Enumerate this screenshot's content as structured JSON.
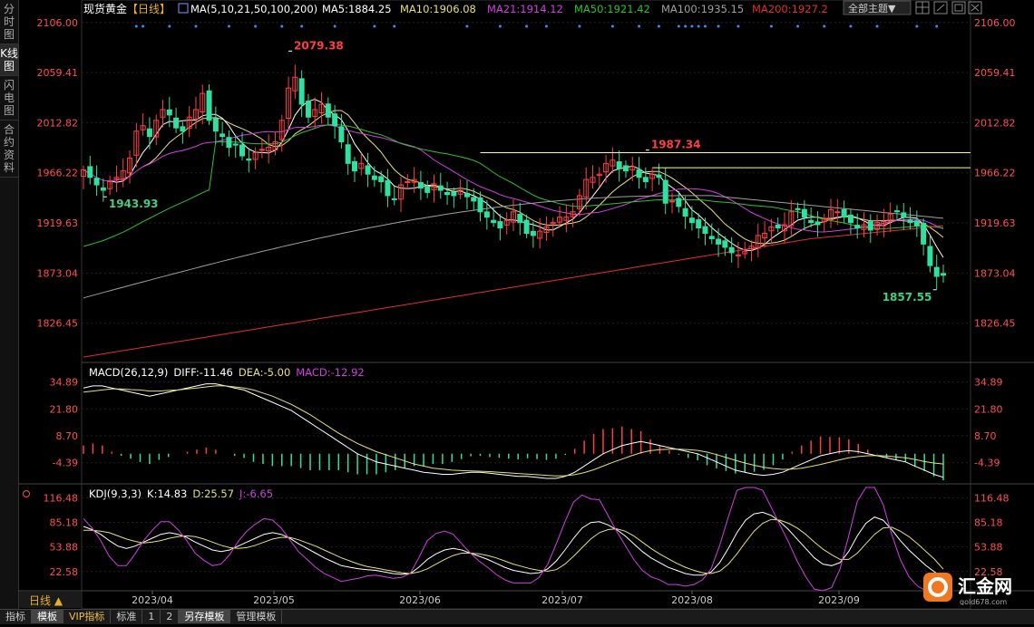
{
  "sidebar": {
    "tabs": [
      {
        "label": "分时图",
        "active": false
      },
      {
        "label": "K线图",
        "active": true
      },
      {
        "label": "闪电图",
        "active": false
      },
      {
        "label": "合约资料",
        "active": false
      }
    ]
  },
  "header": {
    "symbol": "现货黄金",
    "period": "【日线】",
    "ma_params": "MA(5,10,21,50,100,200)",
    "ma_values": [
      {
        "text": "MA5:1884.25",
        "color": "#ffffff"
      },
      {
        "text": "MA10:1906.08",
        "color": "#e8e070"
      },
      {
        "text": "MA21:1914.12",
        "color": "#d040e0"
      },
      {
        "text": "MA50:1921.42",
        "color": "#30c030"
      },
      {
        "text": "MA100:1935.15",
        "color": "#a0a0a0"
      },
      {
        "text": "MA200:1927.2",
        "color": "#e03030"
      }
    ],
    "theme_select": "全部主题▼",
    "toolbar_icons": [
      "window-layout-icon",
      "expand-icon",
      "restore-icon",
      "close-icon"
    ]
  },
  "chart_data": [
    {
      "type": "candlestick",
      "title": "现货黄金 日线",
      "ylim": [
        1790,
        2110
      ],
      "y_ticks": [
        "2106.00",
        "2059.41",
        "2012.82",
        "1966.22",
        "1919.63",
        "1873.04",
        "1826.45"
      ],
      "x_ticks": [
        "2023/04",
        "2023/05",
        "2023/06",
        "2023/07",
        "2023/08",
        "2023/09"
      ],
      "period_selector": "日线 ▲",
      "annotations": [
        {
          "label": "2079.38",
          "value": 2079.38,
          "color": "#ff4040"
        },
        {
          "label": "1987.34",
          "value": 1987.34,
          "color": "#ff4040"
        },
        {
          "label": "1943.93",
          "value": 1943.93,
          "color": "#40d080"
        },
        {
          "label": "1857.55",
          "value": 1857.55,
          "color": "#40d080"
        }
      ],
      "horizontal_lines": [
        {
          "value": 1985,
          "color": "#ffff80"
        },
        {
          "value": 1971,
          "color": "#ffff80"
        }
      ],
      "closes": [
        1969,
        1962,
        1955,
        1950,
        1958,
        1962,
        1968,
        1980,
        2005,
        2010,
        2000,
        2015,
        2025,
        2020,
        2008,
        2005,
        2018,
        2025,
        2040,
        2015,
        2005,
        2000,
        1990,
        1992,
        1982,
        1978,
        1985,
        1988,
        1990,
        1995,
        2015,
        2045,
        2055,
        2030,
        2018,
        2025,
        2030,
        2018,
        2010,
        1995,
        1975,
        1968,
        1975,
        1965,
        1960,
        1958,
        1945,
        1942,
        1955,
        1958,
        1960,
        1952,
        1948,
        1956,
        1950,
        1946,
        1945,
        1950,
        1944,
        1940,
        1930,
        1925,
        1920,
        1915,
        1922,
        1930,
        1920,
        1910,
        1908,
        1912,
        1916,
        1920,
        1925,
        1925,
        1930,
        1945,
        1960,
        1962,
        1965,
        1975,
        1978,
        1970,
        1968,
        1972,
        1962,
        1958,
        1965,
        1962,
        1938,
        1940,
        1935,
        1926,
        1920,
        1915,
        1910,
        1905,
        1900,
        1897,
        1892,
        1890,
        1893,
        1898,
        1908,
        1910,
        1916,
        1915,
        1918,
        1930,
        1932,
        1925,
        1920,
        1918,
        1924,
        1932,
        1930,
        1925,
        1920,
        1915,
        1918,
        1913,
        1920,
        1921,
        1928,
        1930,
        1925,
        1920,
        1917,
        1900,
        1880,
        1870,
        1871
      ],
      "series": [
        {
          "name": "MA5",
          "color": "#ffffff"
        },
        {
          "name": "MA10",
          "color": "#e8e070"
        },
        {
          "name": "MA21",
          "color": "#d040e0"
        },
        {
          "name": "MA50",
          "color": "#30c030"
        },
        {
          "name": "MA100",
          "color": "#a0a0a0"
        },
        {
          "name": "MA200",
          "color": "#e03030"
        }
      ]
    },
    {
      "type": "bar+line",
      "title": "MACD(26,12,9)",
      "legend": [
        {
          "text": "MACD(26,12,9)",
          "color": "#ffffff"
        },
        {
          "text": "DIFF:-11.46",
          "color": "#ffffff"
        },
        {
          "text": "DEA:-5.00",
          "color": "#e8e070"
        },
        {
          "text": "MACD:-12.92",
          "color": "#d040e0"
        }
      ],
      "ylim": [
        -12,
        40
      ],
      "y_ticks": [
        "34.89",
        "21.80",
        "8.70",
        "-4.39"
      ],
      "series": [
        {
          "name": "DIFF",
          "color": "#ffffff",
          "values": [
            32,
            33,
            33,
            32,
            31,
            30,
            29,
            28,
            29,
            30,
            31,
            32,
            33,
            34,
            34,
            33,
            32,
            31,
            29,
            27,
            25,
            23,
            21,
            18,
            15,
            12,
            9,
            6,
            3,
            0,
            -2,
            -4,
            -5,
            -6,
            -7,
            -8,
            -9,
            -9.5,
            -10,
            -10,
            -9.5,
            -9,
            -9,
            -9.5,
            -10,
            -10.5,
            -11,
            -11,
            -11.5,
            -12,
            -12,
            -11,
            -9,
            -6,
            -3,
            0,
            2,
            4,
            5,
            6,
            5,
            4,
            3,
            2,
            1,
            0,
            -2,
            -4,
            -6,
            -8,
            -9,
            -10,
            -10.5,
            -10,
            -9,
            -7,
            -5,
            -3,
            -1,
            0,
            1,
            1.5,
            1,
            0,
            -1,
            -2,
            -3,
            -4,
            -6,
            -8,
            -10,
            -11.46
          ]
        },
        {
          "name": "DEA",
          "color": "#e8e070",
          "values": [
            30,
            30.5,
            31,
            31.5,
            31.5,
            31.2,
            31,
            30.5,
            30.5,
            30.8,
            31,
            31.5,
            32,
            32.5,
            33,
            33,
            32.5,
            32,
            31,
            29.5,
            28,
            26,
            24,
            21.5,
            19,
            16,
            13,
            10,
            7.5,
            5,
            3,
            1,
            -0.5,
            -2,
            -3.5,
            -5,
            -6,
            -7,
            -7.5,
            -8,
            -8.2,
            -8.4,
            -8.5,
            -8.7,
            -9,
            -9.3,
            -9.6,
            -9.9,
            -10.2,
            -10.5,
            -10.8,
            -10.7,
            -10.2,
            -9.2,
            -7.8,
            -6,
            -4.2,
            -2.6,
            -1,
            0.5,
            1.5,
            2,
            2.2,
            2.2,
            2,
            1.6,
            0.8,
            -0.4,
            -1.8,
            -3.2,
            -4.5,
            -5.6,
            -6.6,
            -7.2,
            -7.6,
            -7.5,
            -7,
            -6.2,
            -5.2,
            -4.1,
            -3,
            -2,
            -1.4,
            -1,
            -0.9,
            -1.1,
            -1.5,
            -2,
            -2.8,
            -3.8,
            -4.5,
            -5
          ]
        }
      ]
    },
    {
      "type": "line",
      "title": "KDJ(9,3,3)",
      "legend": [
        {
          "text": "KDJ(9,3,3)",
          "color": "#ffffff"
        },
        {
          "text": "K:14.83",
          "color": "#ffffff"
        },
        {
          "text": "D:25.57",
          "color": "#e8e070"
        },
        {
          "text": "J:-6.65",
          "color": "#d040e0"
        }
      ],
      "ylim": [
        5,
        125
      ],
      "y_ticks": [
        "116.48",
        "85.18",
        "53.88",
        "22.58"
      ],
      "series": [
        {
          "name": "K",
          "color": "#ffffff",
          "values": [
            80,
            76,
            70,
            62,
            55,
            52,
            55,
            60,
            65,
            70,
            72,
            70,
            66,
            60,
            55,
            50,
            48,
            50,
            55,
            60,
            65,
            70,
            72,
            70,
            65,
            58,
            52,
            46,
            40,
            35,
            30,
            28,
            26,
            25,
            24,
            22,
            20,
            19,
            20,
            28,
            38,
            45,
            50,
            52,
            50,
            46,
            42,
            38,
            33,
            28,
            24,
            22,
            20,
            21,
            26,
            36,
            50,
            65,
            78,
            85,
            86,
            82,
            76,
            68,
            58,
            48,
            40,
            34,
            28,
            24,
            20,
            18,
            18,
            22,
            34,
            52,
            72,
            88,
            96,
            98,
            94,
            86,
            76,
            64,
            52,
            40,
            32,
            30,
            34,
            48,
            68,
            84,
            92,
            88,
            76,
            62,
            50,
            40,
            30,
            22,
            14.83
          ]
        },
        {
          "name": "D",
          "color": "#e8e070",
          "values": [
            75,
            75,
            74,
            72,
            68,
            64,
            61,
            59,
            60,
            62,
            65,
            67,
            68,
            67,
            64,
            60,
            56,
            53,
            52,
            53,
            56,
            60,
            64,
            66,
            66,
            63,
            59,
            55,
            50,
            45,
            40,
            36,
            32,
            29,
            27,
            25,
            23,
            21,
            20,
            22,
            26,
            32,
            38,
            43,
            46,
            46,
            45,
            43,
            40,
            36,
            32,
            29,
            26,
            24,
            23,
            25,
            32,
            42,
            53,
            64,
            72,
            76,
            77,
            74,
            68,
            60,
            52,
            45,
            39,
            33,
            28,
            24,
            21,
            20,
            23,
            32,
            45,
            60,
            74,
            84,
            89,
            88,
            84,
            78,
            70,
            60,
            51,
            44,
            38,
            38,
            46,
            58,
            70,
            78,
            79,
            74,
            67,
            58,
            48,
            38,
            25.57
          ]
        },
        {
          "name": "J",
          "color": "#d040e0",
          "values": [
            90,
            78,
            62,
            42,
            30,
            30,
            45,
            62,
            75,
            86,
            86,
            76,
            62,
            46,
            37,
            30,
            32,
            44,
            61,
            74,
            83,
            90,
            88,
            78,
            63,
            48,
            38,
            28,
            20,
            15,
            10,
            12,
            14,
            17,
            18,
            16,
            14,
            15,
            20,
            40,
            62,
            71,
            74,
            70,
            58,
            46,
            36,
            28,
            19,
            12,
            8,
            8,
            8,
            15,
            32,
            58,
            86,
            111,
            120,
            115,
            114,
            94,
            74,
            56,
            38,
            24,
            16,
            12,
            6,
            6,
            4,
            6,
            12,
            26,
            56,
            92,
            126,
            144,
            140,
            126,
            104,
            82,
            60,
            36,
            16,
            0,
            -6,
            2,
            26,
            68,
            112,
            136,
            136,
            108,
            70,
            38,
            16,
            4,
            -6,
            -10,
            -6.65
          ]
        }
      ]
    }
  ],
  "bottom_tabs": [
    {
      "label": "指标",
      "active": false
    },
    {
      "label": "模板",
      "active": true
    },
    {
      "label": "VIP指标",
      "active": false
    },
    {
      "label": "标准",
      "active": false
    },
    {
      "label": "1",
      "active": false
    },
    {
      "label": "2",
      "active": false
    },
    {
      "label": "另存模板",
      "active": true
    },
    {
      "label": "管理模板",
      "active": false
    }
  ],
  "logo": {
    "text": "汇金网",
    "url_text": "gold678.com"
  }
}
